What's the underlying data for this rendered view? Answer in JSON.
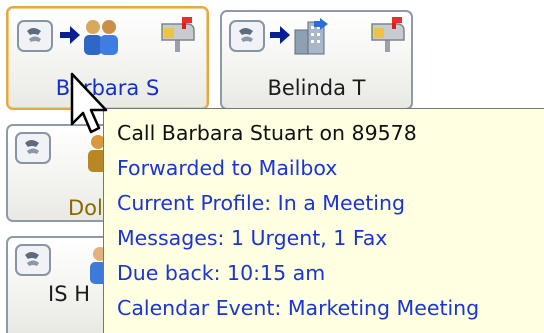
{
  "contacts": [
    {
      "name": "Barbara S",
      "selected": true,
      "status_color": "#1330c8"
    },
    {
      "name": "Belinda T",
      "selected": false
    },
    {
      "name": "Dol",
      "selected": false
    },
    {
      "name": "IS H",
      "selected": false
    }
  ],
  "icons": {
    "phone": "phone-handset-icon",
    "forward": "forward-arrow-icon",
    "people": "people-icon",
    "building": "building-icon",
    "mailbox": "mailbox-icon",
    "person": "person-icon",
    "pointer": "mouse-pointer-icon"
  },
  "tooltip": {
    "lines": [
      "Call Barbara Stuart on 89578",
      "Forwarded to Mailbox",
      "Current Profile: In a Meeting",
      "Messages: 1 Urgent, 1 Fax",
      "Due back: 10:15 am",
      "Calendar Event: Marketing Meeting"
    ]
  },
  "colors": {
    "tooltip_bg": "#ffffe1",
    "tooltip_text": "#111111",
    "tooltip_link": "#1b34d6",
    "selected_border": "#e3a847"
  }
}
